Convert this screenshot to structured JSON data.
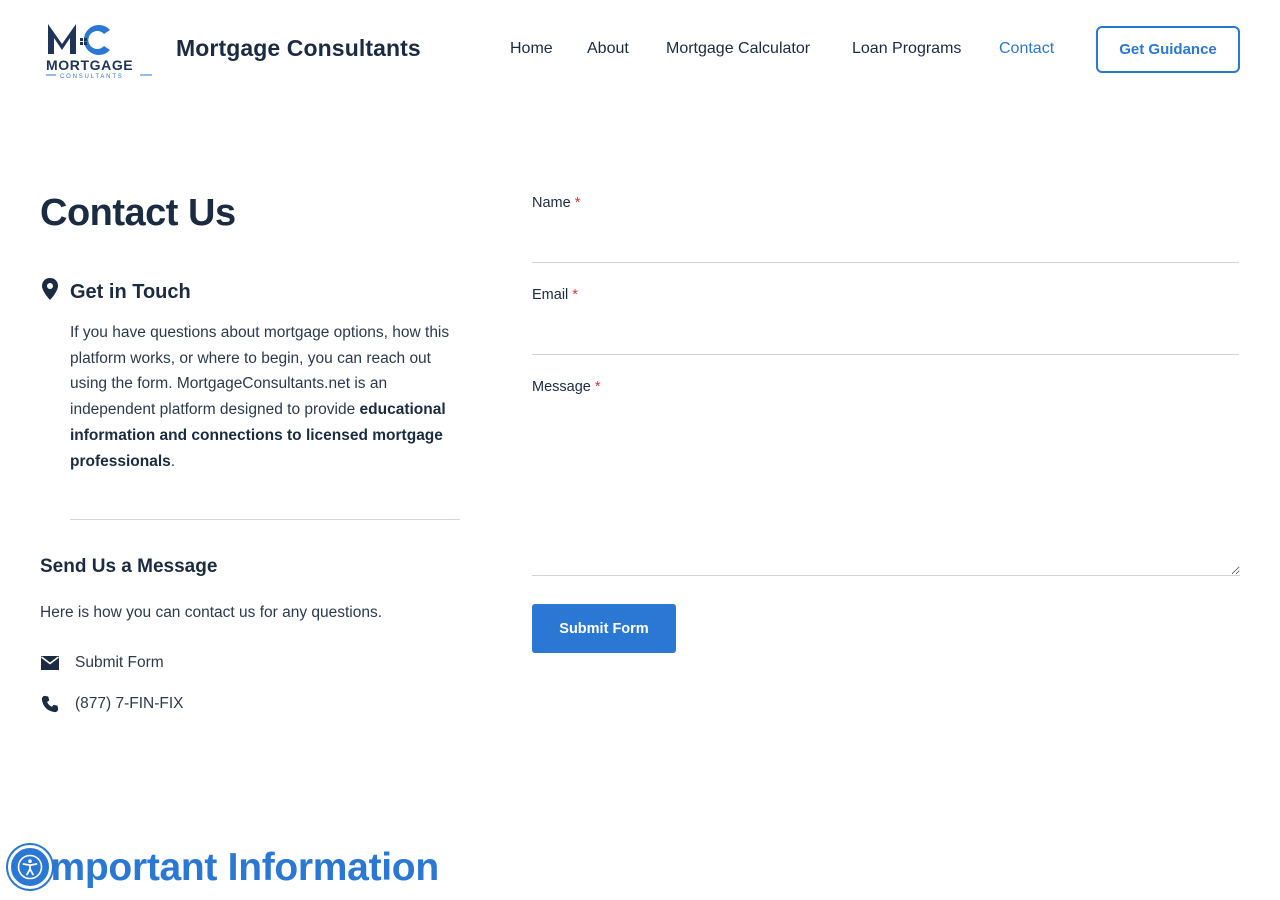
{
  "brand": {
    "name": "Mortgage Consultants",
    "logo_text": "MORTGAGE",
    "logo_subtext": "CONSULTANTS"
  },
  "nav": {
    "items": [
      {
        "label": "Home",
        "active": false
      },
      {
        "label": "About",
        "active": false
      },
      {
        "label": "Mortgage Calculator",
        "active": false
      },
      {
        "label": "Loan Programs",
        "active": false
      },
      {
        "label": "Contact",
        "active": true
      }
    ],
    "cta_label": "Get Guidance"
  },
  "page": {
    "title": "Contact Us"
  },
  "get_in_touch": {
    "title": "Get in Touch",
    "text_before": "If you have questions about mortgage options, how this platform works, or where to begin, you can reach out using the form. MortgageConsultants.net is an independent platform designed to provide ",
    "text_bold": "educational information and connections to licensed mortgage professionals",
    "text_after": "."
  },
  "send_message": {
    "title": "Send Us a Message",
    "text": "Here is how you can contact us for any questions.",
    "submit_link": "Submit Form",
    "phone": "(877) 7-FIN-FIX"
  },
  "form": {
    "name_label": "Name",
    "email_label": "Email",
    "message_label": "Message",
    "required_marker": "*",
    "name_value": "",
    "email_value": "",
    "message_value": "",
    "submit_label": "Submit Form"
  },
  "bottom": {
    "heading": "Important Information"
  },
  "icons": {
    "location": "map-pin-icon",
    "email": "envelope-icon",
    "phone": "phone-icon",
    "accessibility": "accessibility-icon"
  },
  "colors": {
    "accent": "#2a78d4",
    "text_dark": "#1b2b42",
    "required": "#d63638"
  }
}
